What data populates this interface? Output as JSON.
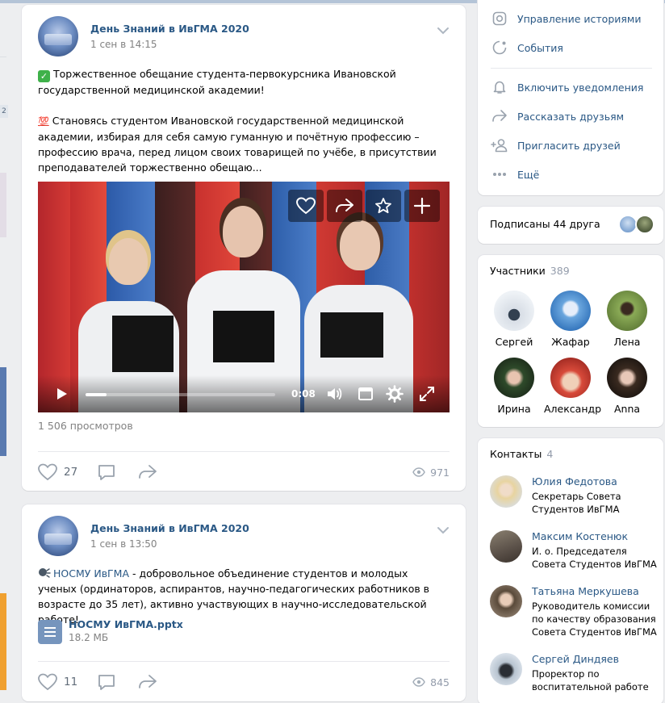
{
  "posts": [
    {
      "group": "День Знаний в ИвГМА 2020",
      "time": "1 сен в 14:15",
      "text1": "Торжественное обещание студента-первокурсника Ивановской государственной медицинской академии!",
      "emoji100": "💯",
      "text2": "Становясь студентом Ивановской государственной медицинской академии, избирая для себя самую гуманную и почётную профессию – профессию врача, перед лицом своих товарищей по учёбе, в присутствии преподавателей торжественно обещаю...",
      "video": {
        "time": "0:08",
        "progress": 0.11
      },
      "views_text": "1 506 просмотров",
      "likes": "27",
      "views": "971"
    },
    {
      "group": "День Знаний в ИвГМА 2020",
      "time": "1 сен в 13:50",
      "link": "НОСМУ ИвГМА",
      "text": " - добровольное объединение студентов и молодых ученых (ординаторов, аспирантов, научно-педагогических работников в возрасте до 35 лет), активно участвующих в научно-исследовательской работе!",
      "doc_name": "НОСМУ ИвГМА.pptx",
      "doc_size": "18.2 МБ",
      "likes": "11",
      "views": "845"
    }
  ],
  "menu": {
    "stories": "Управление историями",
    "events": "События",
    "notify": "Включить уведомления",
    "share": "Рассказать друзьям",
    "invite": "Пригласить друзей",
    "more": "Ещё"
  },
  "friends": {
    "label": "Подписаны 44 друга"
  },
  "members": {
    "title": "Участники",
    "count": "389",
    "items": [
      {
        "name": "Сергей",
        "color": "#9aa7b8"
      },
      {
        "name": "Жафар",
        "color": "#4a8fd0"
      },
      {
        "name": "Лена",
        "color": "#7a9a4a"
      },
      {
        "name": "Ирина",
        "color": "#3a5a3a"
      },
      {
        "name": "Александр",
        "color": "#c84a3a"
      },
      {
        "name": "Anna",
        "color": "#4a3a2e"
      }
    ]
  },
  "contacts": {
    "title": "Контакты",
    "count": "4",
    "items": [
      {
        "name": "Юлия Федотова",
        "role": "Секретарь Совета Студентов ИвГМА"
      },
      {
        "name": "Максим Костенюк",
        "role": "И. о. Председателя Совета Студентов ИвГМА"
      },
      {
        "name": "Татьяна Меркушева",
        "role": "Руководитель комиссии по качеству образования Совета Студентов ИвГМА"
      },
      {
        "name": "Сергей Диндяев",
        "role": "Проректор по воспитательной работе"
      }
    ]
  },
  "colors": {
    "link": "#2a5885",
    "muted": "#828282",
    "bg": "#edeef0",
    "accent": "#4a76a8"
  },
  "left_badge": "2"
}
